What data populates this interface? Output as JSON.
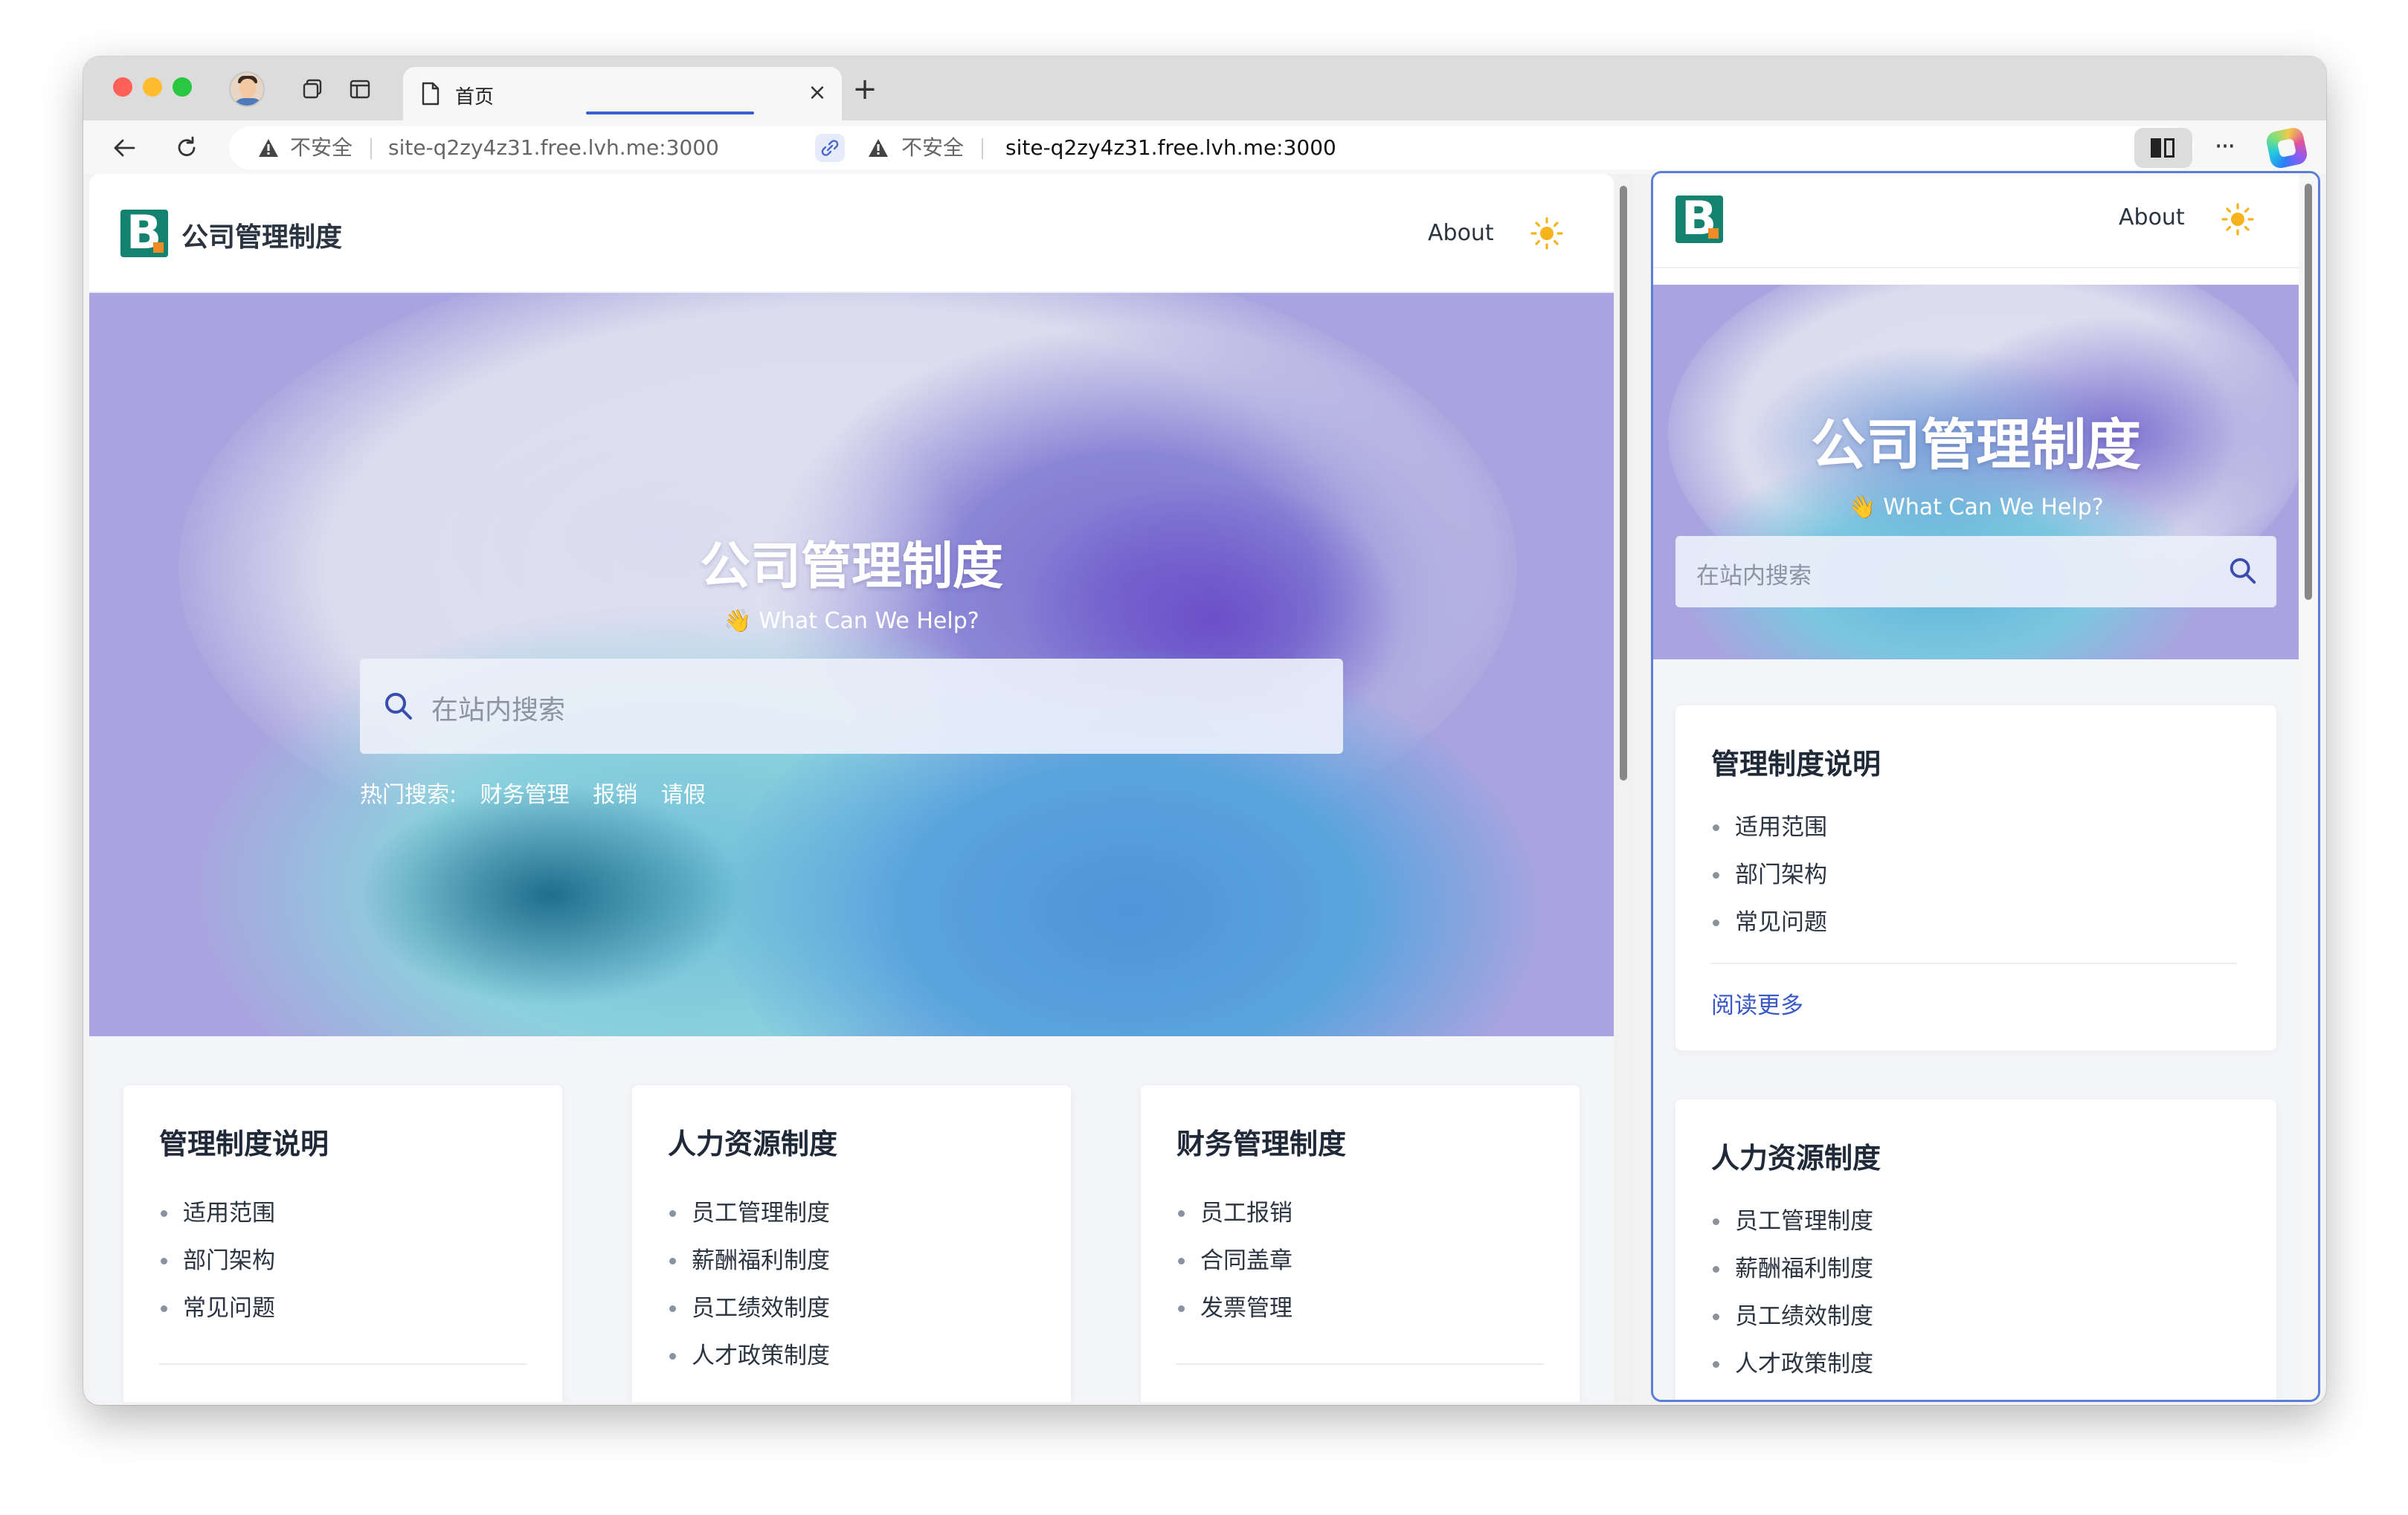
{
  "browser": {
    "tab_title": "首页",
    "insecure_label": "不安全",
    "url": "site-q2zy4z31.free.lvh.me:3000",
    "url_secondary": "site-q2zy4z31.free.lvh.me:3000",
    "new_tab_symbol": "+",
    "close_symbol": "×",
    "more_symbol": "···"
  },
  "site": {
    "name": "公司管理制度",
    "nav_about": "About",
    "hero_title": "公司管理制度",
    "hero_subtitle": "👋 What Can We Help?",
    "search_placeholder": "在站内搜索",
    "hot_label": "热门搜索:",
    "hot_terms": [
      "财务管理",
      "报销",
      "请假"
    ],
    "read_more": "阅读更多",
    "colors": {
      "logo": "#13826e",
      "accent": "#3a58c8",
      "hero": "#a9a4df"
    }
  },
  "cards": [
    {
      "title": "管理制度说明",
      "items": [
        "适用范围",
        "部门架构",
        "常见问题"
      ]
    },
    {
      "title": "人力资源制度",
      "items": [
        "员工管理制度",
        "薪酬福利制度",
        "员工绩效制度",
        "人才政策制度"
      ]
    },
    {
      "title": "财务管理制度",
      "items": [
        "员工报销",
        "合同盖章",
        "发票管理"
      ]
    }
  ]
}
